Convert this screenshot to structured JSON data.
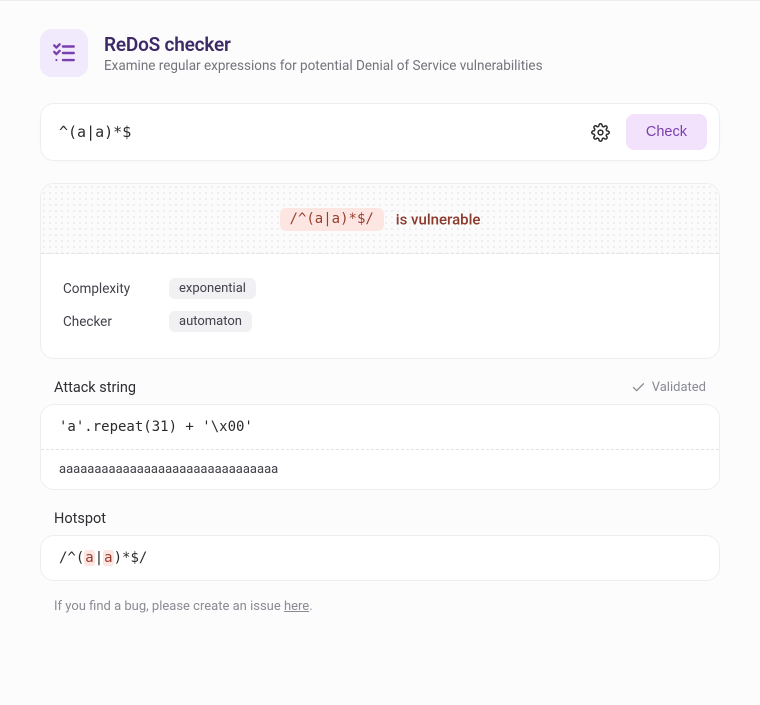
{
  "header": {
    "title": "ReDoS checker",
    "subtitle": "Examine regular expressions for potential Denial of Service vulnerabilities"
  },
  "input": {
    "value": "^(a|a)*$",
    "check_label": "Check"
  },
  "result": {
    "regex_display": "/^(a|a)*$/",
    "verdict": "is vulnerable",
    "rows": {
      "complexity": {
        "label": "Complexity",
        "value": "exponential"
      },
      "checker": {
        "label": "Checker",
        "value": "automaton"
      }
    }
  },
  "attack": {
    "label": "Attack string",
    "validated": "Validated",
    "code": "'a'.repeat(31) + '\\x00'",
    "output": "aaaaaaaaaaaaaaaaaaaaaaaaaaaaaaa"
  },
  "hotspot": {
    "label": "Hotspot",
    "pre": "/^(",
    "hl1": "a",
    "mid": "|",
    "hl2": "a",
    "post": ")*$/"
  },
  "footer": {
    "pre": "If you find a bug, please create an issue ",
    "link": "here",
    "post": "."
  }
}
